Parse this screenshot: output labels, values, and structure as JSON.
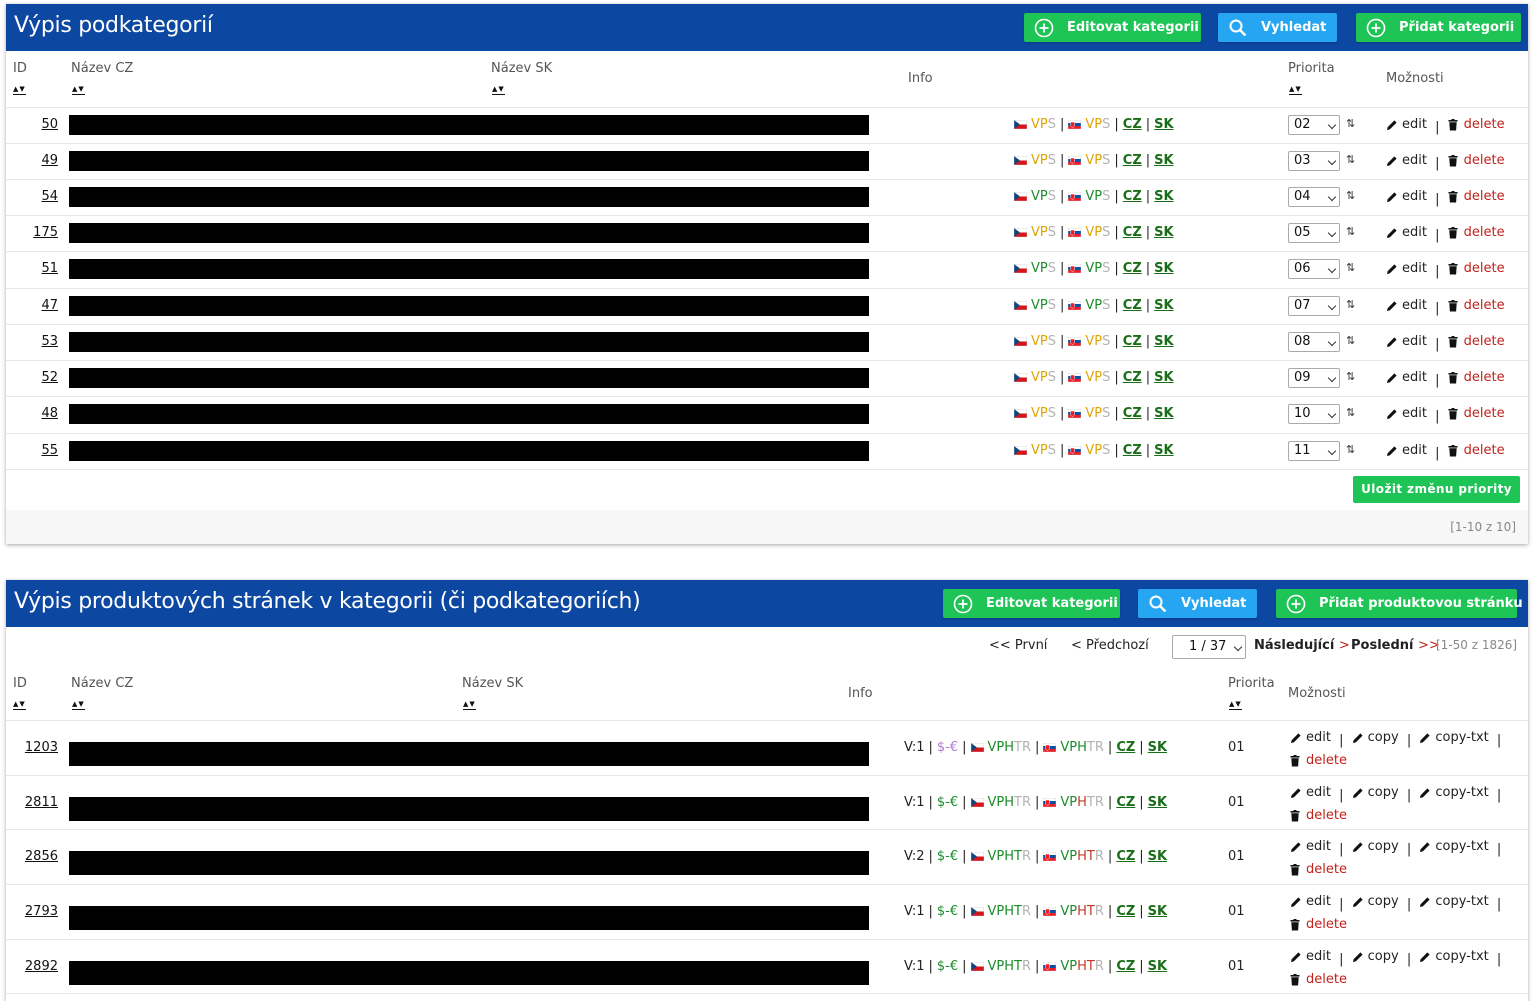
{
  "panel1": {
    "title": "Výpis podkategorií",
    "buttons": {
      "edit": "Editovat kategorii",
      "search": "Vyhledat",
      "add": "Přidat kategorii"
    },
    "columns": {
      "id": "ID",
      "name_cz": "Název CZ",
      "name_sk": "Název SK",
      "info": "Info",
      "priority": "Priorita",
      "options": "Možnosti"
    },
    "sort_glyph": "▲▼",
    "rows": [
      {
        "id": "50",
        "priority": "02",
        "cz_vp": "orange",
        "sk_vp": "orange"
      },
      {
        "id": "49",
        "priority": "03",
        "cz_vp": "orange",
        "sk_vp": "orange"
      },
      {
        "id": "54",
        "priority": "04",
        "cz_vp": "green",
        "sk_vp": "green"
      },
      {
        "id": "175",
        "priority": "05",
        "cz_vp": "orange",
        "sk_vp": "orange"
      },
      {
        "id": "51",
        "priority": "06",
        "cz_vp": "green",
        "sk_vp": "green"
      },
      {
        "id": "47",
        "priority": "07",
        "cz_vp": "green",
        "sk_vp": "green"
      },
      {
        "id": "53",
        "priority": "08",
        "cz_vp": "orange",
        "sk_vp": "orange"
      },
      {
        "id": "52",
        "priority": "09",
        "cz_vp": "orange",
        "sk_vp": "orange"
      },
      {
        "id": "48",
        "priority": "10",
        "cz_vp": "orange",
        "sk_vp": "orange"
      },
      {
        "id": "55",
        "priority": "11",
        "cz_vp": "orange",
        "sk_vp": "orange"
      }
    ],
    "info_text": {
      "vp": "VP",
      "s": "S",
      "cz": "CZ",
      "sk": "SK",
      "sep": "|"
    },
    "updown": "⇅",
    "actions": {
      "edit": "edit",
      "delete": "delete"
    },
    "save_priority": "Uložit změnu priority",
    "count": "[1-10 z 10]"
  },
  "panel2": {
    "title": "Výpis produktových stránek v kategorii (či podkategoriích)",
    "buttons": {
      "edit": "Editovat kategorii",
      "search": "Vyhledat",
      "add": "Přidat produktovou stránku"
    },
    "pager": {
      "first": "<< První",
      "prev": "< Předchozí",
      "page": "1 / 37",
      "next_label": "Následující",
      "next_arrow": ">",
      "last_label": "Poslední",
      "last_arrow": ">>",
      "count": "[1-50 z 1826]"
    },
    "columns": {
      "id": "ID",
      "name_cz": "Název CZ",
      "name_sk": "Název SK",
      "info": "Info",
      "priority": "Priorita",
      "options": "Možnosti"
    },
    "rows": [
      {
        "id": "1203",
        "v": "V:1",
        "money": "$-€",
        "money_color": "purple",
        "cz_tr": "gray",
        "sk_tr": "gray",
        "sk_h": "green",
        "priority": "01"
      },
      {
        "id": "2811",
        "v": "V:1",
        "money": "$-€",
        "money_color": "green",
        "cz_tr": "gray",
        "sk_tr": "gray",
        "sk_h": "red",
        "priority": "01"
      },
      {
        "id": "2856",
        "v": "V:2",
        "money": "$-€",
        "money_color": "green",
        "cz_tr": "green_r_gray",
        "sk_tr": "red_r_gray",
        "sk_h": "red",
        "priority": "01"
      },
      {
        "id": "2793",
        "v": "V:1",
        "money": "$-€",
        "money_color": "green",
        "cz_tr": "green_r_gray",
        "sk_tr": "red_r_gray",
        "sk_h": "red",
        "priority": "01"
      },
      {
        "id": "2892",
        "v": "V:1",
        "money": "$-€",
        "money_color": "green",
        "cz_tr": "green_r_gray",
        "sk_tr": "red_r_gray",
        "sk_h": "red",
        "priority": "01"
      }
    ],
    "info_text": {
      "vph": "VPH",
      "vp": "VP",
      "h": "H",
      "t": "T",
      "r": "R",
      "cz": "CZ",
      "sk": "SK"
    },
    "actions": {
      "edit": "edit",
      "copy": "copy",
      "copy_txt": "copy-txt",
      "delete": "delete",
      "sep": "|"
    }
  },
  "colors": {
    "header": "#0c47a1",
    "green_button": "#1ec456",
    "blue_button": "#26a6f2",
    "delete": "#c0221c",
    "lang_link": "#1a6e1a"
  }
}
